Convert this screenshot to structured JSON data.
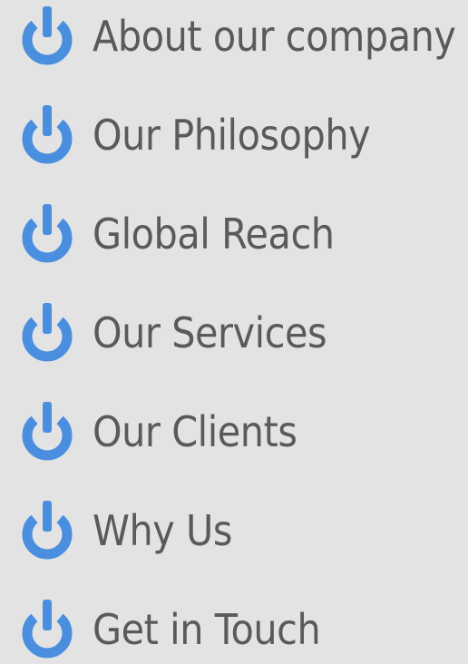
{
  "colors": {
    "background": "#e3e3e3",
    "icon": "#4a8fdf",
    "text": "#5a5a5a"
  },
  "menu": {
    "items": [
      {
        "label": "About our company",
        "icon": "power-icon"
      },
      {
        "label": "Our Philosophy",
        "icon": "power-icon"
      },
      {
        "label": "Global Reach",
        "icon": "power-icon"
      },
      {
        "label": "Our Services",
        "icon": "power-icon"
      },
      {
        "label": "Our Clients",
        "icon": "power-icon"
      },
      {
        "label": "Why Us",
        "icon": "power-icon"
      },
      {
        "label": "Get in Touch",
        "icon": "power-icon"
      }
    ]
  }
}
